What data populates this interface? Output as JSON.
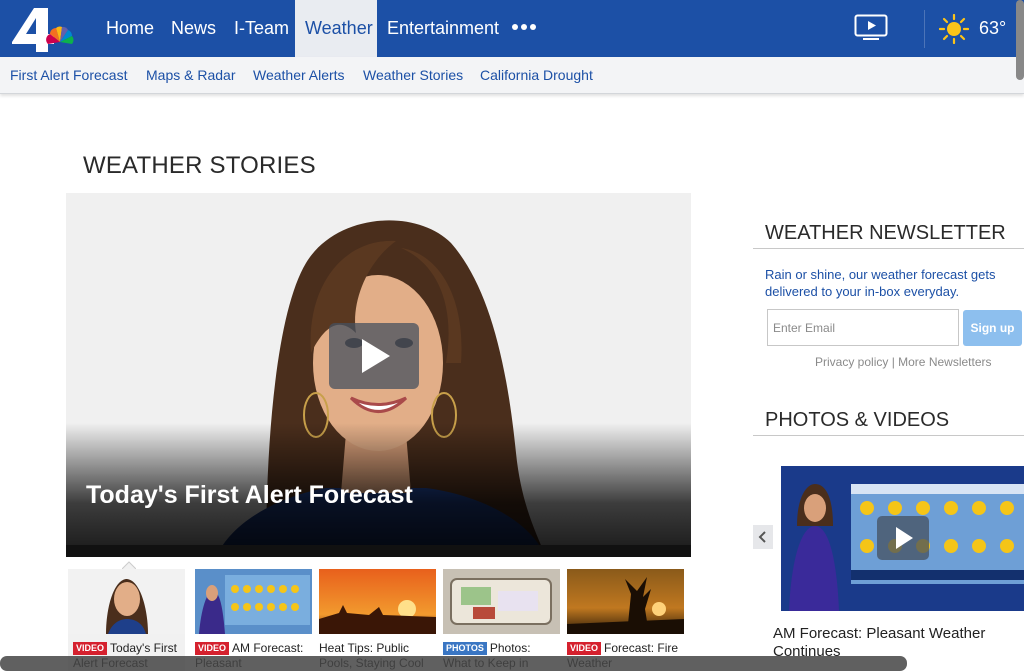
{
  "nav": {
    "logo": "nbc-4-peacock-logo",
    "items": [
      {
        "label": "Home",
        "active": false
      },
      {
        "label": "News",
        "active": false
      },
      {
        "label": "I-Team",
        "active": false
      },
      {
        "label": "Weather",
        "active": true
      },
      {
        "label": "Entertainment",
        "active": false
      }
    ],
    "more_icon": "more-dots-icon",
    "video_icon": "tv-play-icon",
    "weather_icon": "sun-icon",
    "temperature": "63°"
  },
  "subnav": {
    "items": [
      "First Alert Forecast",
      "Maps & Radar",
      "Weather Alerts",
      "Weather Stories",
      "California Drought"
    ]
  },
  "main": {
    "section_title": "WEATHER STORIES",
    "hero": {
      "title": "Today's First Alert Forecast",
      "play_icon": "play-icon"
    },
    "thumbnails": [
      {
        "badge": "VIDEO",
        "caption": "Today's First Alert Forecast"
      },
      {
        "badge": "VIDEO",
        "caption": "AM Forecast: Pleasant"
      },
      {
        "badge": "",
        "caption": "Heat Tips: Public Pools, Staying Cool"
      },
      {
        "badge": "PHOTOS",
        "caption": "Photos: What to Keep in"
      },
      {
        "badge": "VIDEO",
        "caption": "Forecast: Fire Weather"
      }
    ]
  },
  "sidebar": {
    "newsletter": {
      "title": "WEATHER NEWSLETTER",
      "text": "Rain or shine, our weather forecast gets delivered to your in-box everyday.",
      "email_placeholder": "Enter Email",
      "signup_label": "Sign up",
      "links": "Privacy policy | More Newsletters"
    },
    "photos_videos": {
      "title": "PHOTOS & VIDEOS",
      "prev_icon": "chevron-left-icon",
      "caption": "AM Forecast: Pleasant Weather Continues"
    }
  },
  "colors": {
    "brand_blue": "#1c50a6",
    "video_badge": "#d5212e",
    "photos_badge": "#3a76c3",
    "signup_button": "#8dbfee"
  }
}
